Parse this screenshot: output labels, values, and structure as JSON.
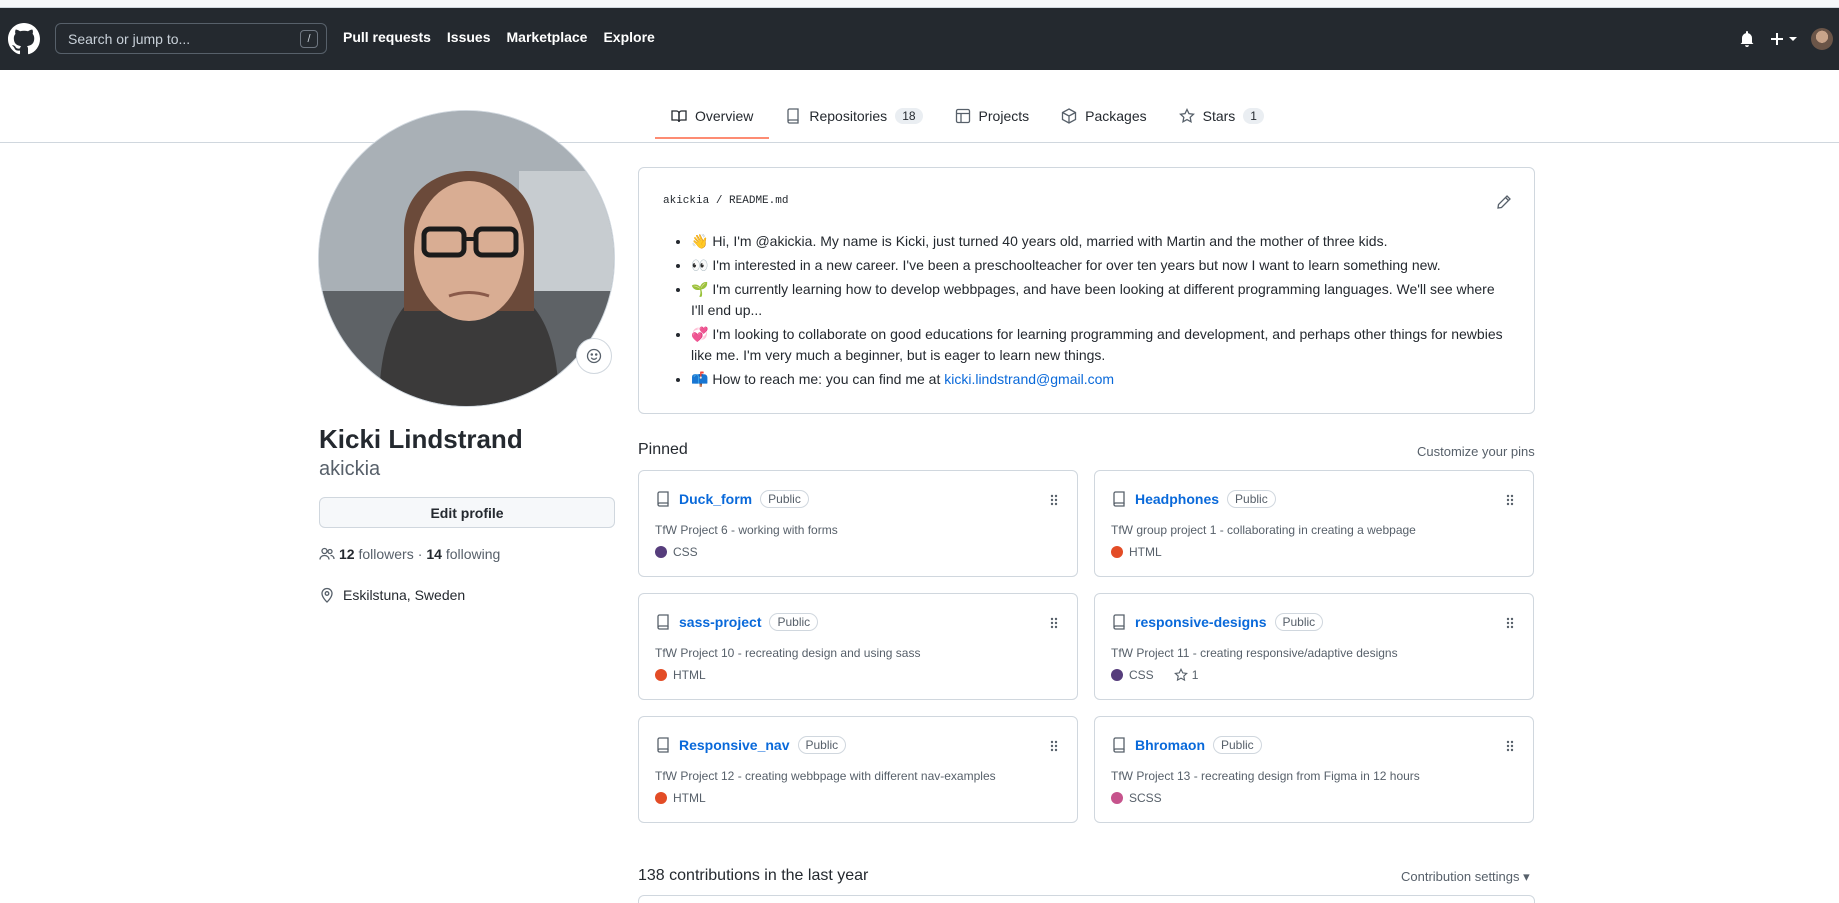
{
  "header": {
    "search_placeholder": "Search or jump to...",
    "search_shortcut": "/",
    "nav": [
      "Pull requests",
      "Issues",
      "Marketplace",
      "Explore"
    ]
  },
  "tabs": [
    {
      "label": "Overview",
      "icon": "book-icon"
    },
    {
      "label": "Repositories",
      "count": "18",
      "icon": "repo-icon"
    },
    {
      "label": "Projects",
      "icon": "table-icon"
    },
    {
      "label": "Packages",
      "icon": "package-icon"
    },
    {
      "label": "Stars",
      "count": "1",
      "icon": "star-icon"
    }
  ],
  "profile": {
    "name": "Kicki Lindstrand",
    "login": "akickia",
    "edit_label": "Edit profile",
    "followers_count": "12",
    "followers_label": "followers",
    "separator": "·",
    "following_count": "14",
    "following_label": "following",
    "location": "Eskilstuna, Sweden"
  },
  "readme": {
    "owner": "akickia",
    "sep": "/",
    "file": "README.md",
    "items": [
      {
        "emoji": "👋",
        "text": "Hi, I'm @akickia. My name is Kicki, just turned 40 years old, married with Martin and the mother of three kids."
      },
      {
        "emoji": "👀",
        "text": "I'm interested in a new career. I've been a preschoolteacher for over ten years but now I want to learn something new."
      },
      {
        "emoji": "🌱",
        "text": "I'm currently learning how to develop webbpages, and have been looking at different programming languages. We'll see where I'll end up..."
      },
      {
        "emoji": "💞",
        "text": "I'm looking to collaborate on good educations for learning programming and development, and perhaps other things for newbies like me. I'm very much a beginner, but is eager to learn new things."
      },
      {
        "emoji": "📫",
        "text": "How to reach me: you can find me at ",
        "link": "kicki.lindstrand@gmail.com"
      }
    ]
  },
  "pinned": {
    "title": "Pinned",
    "customize": "Customize your pins",
    "repos": [
      {
        "name": "Duck_form",
        "badge": "Public",
        "desc": "TfW Project 6 - working with forms",
        "lang": "CSS",
        "color": "#563d7c"
      },
      {
        "name": "Headphones",
        "badge": "Public",
        "desc": "TfW group project 1 - collaborating in creating a webpage",
        "lang": "HTML",
        "color": "#e34c26"
      },
      {
        "name": "sass-project",
        "badge": "Public",
        "desc": "TfW Project 10 - recreating design and using sass",
        "lang": "HTML",
        "color": "#e34c26"
      },
      {
        "name": "responsive-designs",
        "badge": "Public",
        "desc": "TfW Project 11 - creating responsive/adaptive designs",
        "lang": "CSS",
        "color": "#563d7c",
        "stars": "1"
      },
      {
        "name": "Responsive_nav",
        "badge": "Public",
        "desc": "TfW Project 12 - creating webbpage with different nav-examples",
        "lang": "HTML",
        "color": "#e34c26"
      },
      {
        "name": "Bhromaon",
        "badge": "Public",
        "desc": "TfW Project 13 - recreating design from Figma in 12 hours",
        "lang": "SCSS",
        "color": "#c6538c"
      }
    ]
  },
  "contributions": {
    "title": "138 contributions in the last year",
    "settings": "Contribution settings"
  }
}
